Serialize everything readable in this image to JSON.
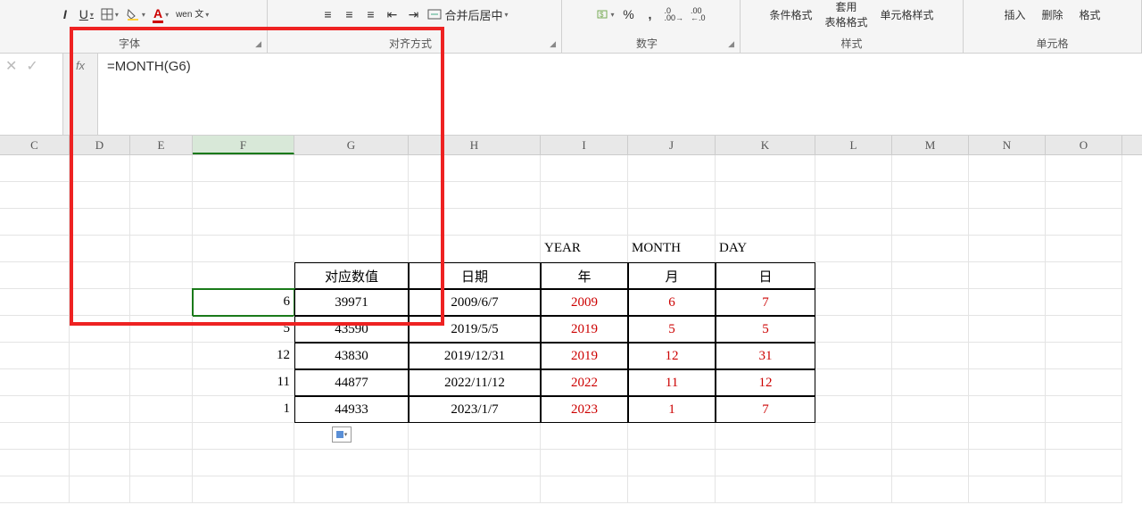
{
  "ribbon": {
    "font_group": "字体",
    "align_group": "对齐方式",
    "number_group": "数字",
    "styles_group": "样式",
    "cells_group": "单元格",
    "merge_center": "合并后居中",
    "cond_fmt": "条件格式",
    "table_fmt": "套用\n表格格式",
    "cell_style": "单元格样式",
    "insert": "插入",
    "delete": "删除",
    "format": "格式",
    "decrease_dec": ".0",
    "increase_dec": ".00",
    "wen": "wen\n文"
  },
  "formula_bar": {
    "fx": "fx",
    "formula": "=MONTH(G6)"
  },
  "columns": [
    "C",
    "D",
    "E",
    "F",
    "G",
    "H",
    "I",
    "J",
    "K",
    "L",
    "M",
    "N",
    "O"
  ],
  "labels": {
    "year_en": "YEAR",
    "month_en": "MONTH",
    "day_en": "DAY",
    "val_col": "对应数值",
    "date_col": "日期",
    "year_col": "年",
    "month_col": "月",
    "day_col": "日"
  },
  "rows": [
    {
      "f": "6",
      "g": "39971",
      "h": "2009/6/7",
      "i": "2009",
      "j": "6",
      "k": "7"
    },
    {
      "f": "5",
      "g": "43590",
      "h": "2019/5/5",
      "i": "2019",
      "j": "5",
      "k": "5"
    },
    {
      "f": "12",
      "g": "43830",
      "h": "2019/12/31",
      "i": "2019",
      "j": "12",
      "k": "31"
    },
    {
      "f": "11",
      "g": "44877",
      "h": "2022/11/12",
      "i": "2022",
      "j": "11",
      "k": "12"
    },
    {
      "f": "1",
      "g": "44933",
      "h": "2023/1/7",
      "i": "2023",
      "j": "1",
      "k": "7"
    }
  ]
}
